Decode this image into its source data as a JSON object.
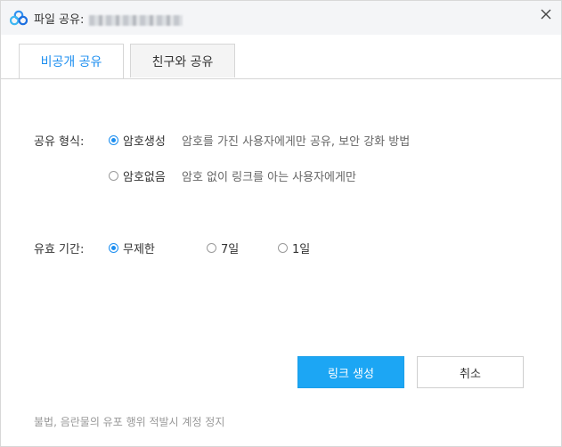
{
  "window": {
    "title_prefix": "파일 공유:",
    "close_icon": "close-icon",
    "logo_icon": "cloud-logo-icon"
  },
  "tabs": [
    {
      "label": "비공개 공유",
      "active": true
    },
    {
      "label": "친구와 공유",
      "active": false
    }
  ],
  "share_type": {
    "label": "공유 형식:",
    "options": [
      {
        "label": "암호생성",
        "description": "암호를 가진 사용자에게만 공유, 보안 강화 방법",
        "checked": true
      },
      {
        "label": "암호없음",
        "description": "암호 없이 링크를 아는 사용자에게만",
        "checked": false
      }
    ]
  },
  "validity": {
    "label": "유효 기간:",
    "options": [
      {
        "label": "무제한",
        "checked": true
      },
      {
        "label": "7일",
        "checked": false
      },
      {
        "label": "1일",
        "checked": false
      }
    ]
  },
  "buttons": {
    "create_link": "링크 생성",
    "cancel": "취소"
  },
  "footer": {
    "note": "불법, 음란물의 유포 행위 적발시 계정 정지"
  },
  "colors": {
    "accent": "#1c8ef0",
    "primary_button": "#1ca6f4",
    "titlebar_bg": "#f4f5f7"
  }
}
